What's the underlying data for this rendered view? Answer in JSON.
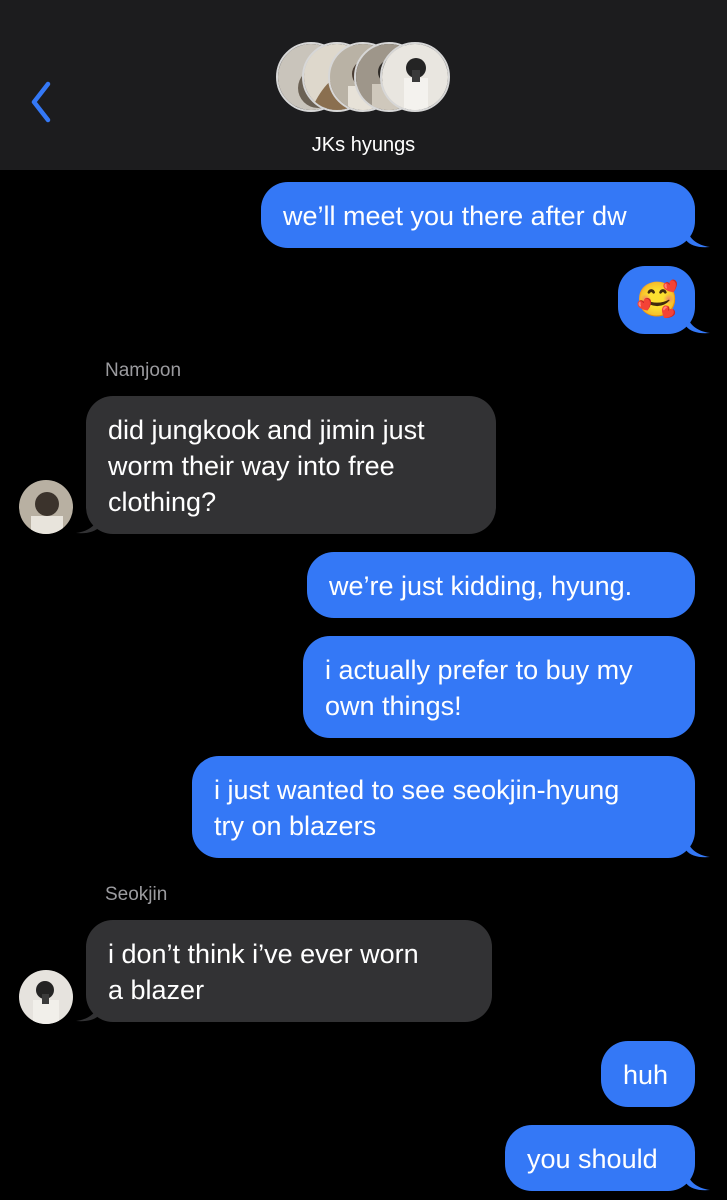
{
  "header": {
    "back_icon": "chevron-left-icon",
    "group_name": "JKs hyungs",
    "accent_color": "#3478f6"
  },
  "messages": [
    {
      "direction": "outgoing",
      "lines": [
        "we’ll meet you there after dw"
      ]
    },
    {
      "direction": "outgoing",
      "lines": [
        "🥰"
      ]
    },
    {
      "direction": "incoming",
      "sender": "Namjoon",
      "lines": [
        "did jungkook and jimin just",
        "worm their way into free",
        "clothing?"
      ]
    },
    {
      "direction": "outgoing",
      "lines": [
        "we’re just kidding, hyung."
      ]
    },
    {
      "direction": "outgoing",
      "lines": [
        "i actually prefer to buy my",
        "own things!"
      ]
    },
    {
      "direction": "outgoing",
      "lines": [
        "i just wanted to see seokjin-hyung",
        "try on blazers"
      ]
    },
    {
      "direction": "incoming",
      "sender": "Seokjin",
      "lines": [
        "i don’t think i’ve ever worn",
        "a blazer"
      ]
    },
    {
      "direction": "outgoing",
      "lines": [
        "huh"
      ]
    },
    {
      "direction": "outgoing",
      "lines": [
        "you should"
      ]
    }
  ]
}
